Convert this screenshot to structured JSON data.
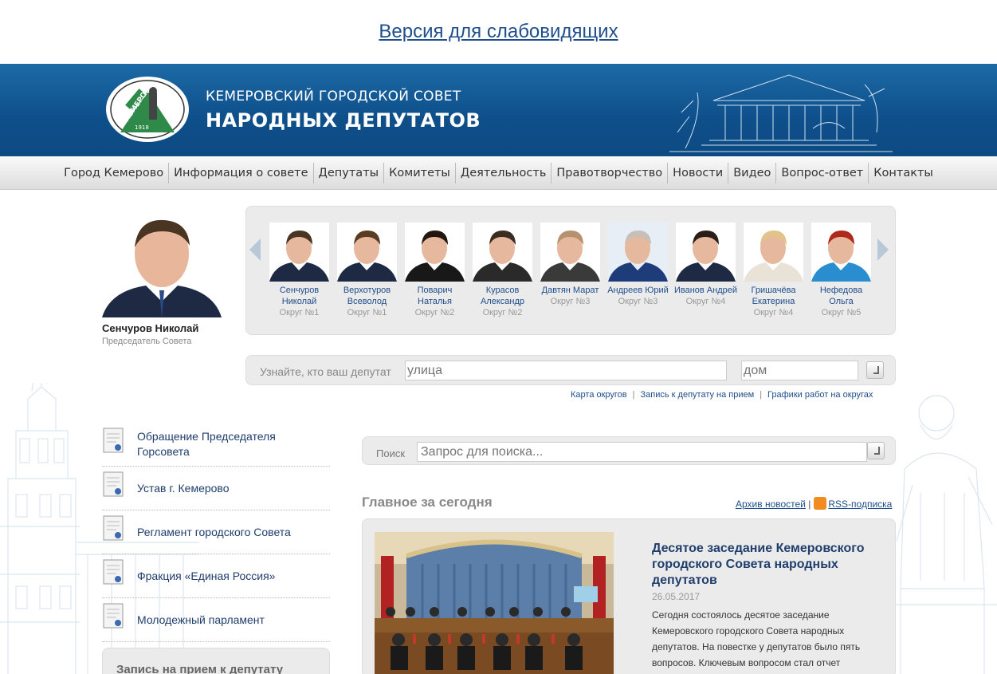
{
  "accessibility_link": "Версия для слабовидящих",
  "header": {
    "title_line1": "КЕМЕРОВСКИЙ ГОРОДСКОЙ СОВЕТ",
    "title_line2": "НАРОДНЫХ ДЕПУТАТОВ",
    "logo_text": "КЕМЕРОВО",
    "logo_ring_text": "ГОРОДСКОЙ СОВЕТ НАРОДНЫХ ДЕПУТАТОВ",
    "logo_year": "1918"
  },
  "nav": [
    "Город Кемерово",
    "Информация о совете",
    "Депутаты",
    "Комитеты",
    "Деятельность",
    "Правотворчество",
    "Новости",
    "Видео",
    "Вопрос-ответ",
    "Контакты"
  ],
  "chairman": {
    "name": "Сенчуров Николай",
    "role": "Председатель Совета"
  },
  "deputies": [
    {
      "name": "Сенчуров Николай",
      "district": "Округ №1",
      "suit": "#1e2a44",
      "hair": "#4a3422",
      "bg": "#ffffff"
    },
    {
      "name": "Верхотуров Всеволод",
      "district": "Округ №1",
      "suit": "#1e2a44",
      "hair": "#5a3c22",
      "bg": "#ffffff"
    },
    {
      "name": "Поварич Наталья",
      "district": "Округ №2",
      "suit": "#181818",
      "hair": "#231510",
      "bg": "#ffffff"
    },
    {
      "name": "Курасов Александр",
      "district": "Округ №2",
      "suit": "#2a2a2a",
      "hair": "#3a2c20",
      "bg": "#ffffff"
    },
    {
      "name": "Давтян Марат",
      "district": "Округ №3",
      "suit": "#3a3a3a",
      "hair": "#b7906f",
      "bg": "#ffffff"
    },
    {
      "name": "Андреев Юрий",
      "district": "Округ №3",
      "suit": "#1f3c7a",
      "hair": "#c6c0b8",
      "bg": "#e8eef5"
    },
    {
      "name": "Иванов Андрей",
      "district": "Округ №4",
      "suit": "#1e2a44",
      "hair": "#2a1f18",
      "bg": "#ffffff"
    },
    {
      "name": "Гришачёва Екатерина",
      "district": "Округ №4",
      "suit": "#e9e2d6",
      "hair": "#e2c48a",
      "bg": "#ffffff"
    },
    {
      "name": "Нефедова Ольга",
      "district": "Округ №5",
      "suit": "#2a8dd0",
      "hair": "#b02a1a",
      "bg": "#ffffff"
    }
  ],
  "finder": {
    "label": "Узнайте, кто ваш депутат",
    "street_placeholder": "улица",
    "house_placeholder": "дом",
    "links": [
      "Карта округов",
      "Запись к депутату на прием",
      "Графики работ на округах"
    ],
    "separator": "|"
  },
  "left_menu": [
    "Обращение Председателя Горсовета",
    "Устав г. Кемерово",
    "Регламент городского Совета",
    "Фракция «Единая Россия»",
    "Молодежный парламент"
  ],
  "appointment_title": "Запись на прием к депутату",
  "search": {
    "label": "Поиск",
    "placeholder": "Запрос для поиска..."
  },
  "news": {
    "heading": "Главное за сегодня",
    "archive_link": "Архив новостей",
    "separator": "|",
    "rss_link": "RSS-подписка",
    "item": {
      "title": "Десятое заседание Кемеровского городского Совета народных депутатов",
      "date": "26.05.2017",
      "text": "Сегодня состоялось десятое заседание Кемеровского городского Совета народных депутатов. На повестке у депутатов было пять вопросов. Ключевым вопросом стал отчет"
    }
  },
  "colors": {
    "header_blue": "#0e4f8a",
    "link_blue": "#1f4e8c",
    "panel_gray": "#ebebeb"
  }
}
